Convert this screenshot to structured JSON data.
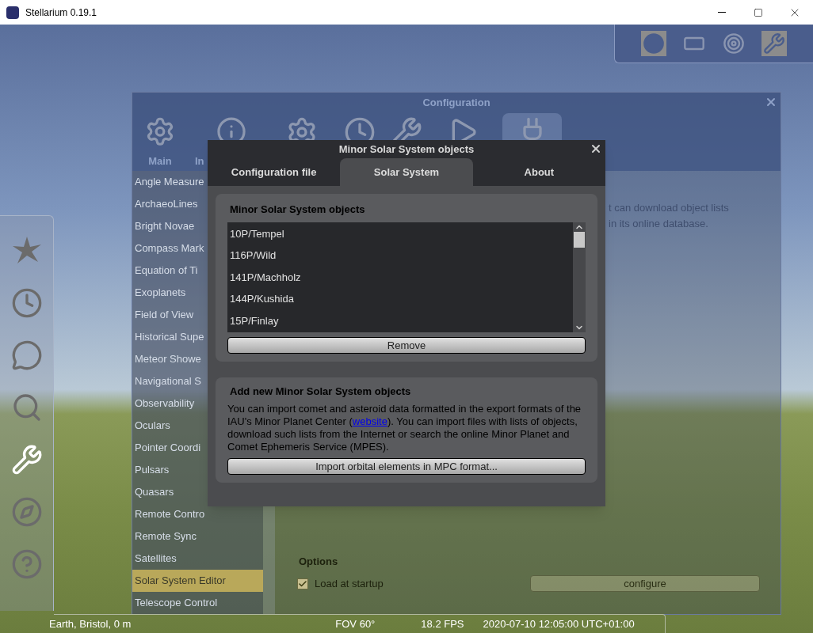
{
  "window": {
    "title": "Stellarium 0.19.1"
  },
  "configuration": {
    "title": "Configuration",
    "tabs": [
      {
        "label": "Main",
        "selected": false
      },
      {
        "label": "In",
        "selected": false
      },
      {
        "selected": false
      },
      {
        "selected": false
      },
      {
        "selected": false
      },
      {
        "selected": false
      },
      {
        "selected": true
      }
    ],
    "plugins": [
      {
        "label": "Angle Measure",
        "selected": false
      },
      {
        "label": "ArchaeoLines",
        "selected": false
      },
      {
        "label": "Bright Novae",
        "selected": false
      },
      {
        "label": "Compass Mark",
        "selected": false
      },
      {
        "label": "Equation of Ti",
        "selected": false
      },
      {
        "label": "Exoplanets",
        "selected": false
      },
      {
        "label": "Field of View",
        "selected": false
      },
      {
        "label": "Historical Supe",
        "selected": false
      },
      {
        "label": "Meteor Showe",
        "selected": false
      },
      {
        "label": "Navigational S",
        "selected": false
      },
      {
        "label": "Observability",
        "selected": false
      },
      {
        "label": "Oculars",
        "selected": false
      },
      {
        "label": "Pointer Coordi",
        "selected": false
      },
      {
        "label": "Pulsars",
        "selected": false
      },
      {
        "label": "Quasars",
        "selected": false
      },
      {
        "label": "Remote Contro",
        "selected": false
      },
      {
        "label": "Remote Sync",
        "selected": false
      },
      {
        "label": "Satellites",
        "selected": false
      },
      {
        "label": "Solar System Editor",
        "selected": true
      },
      {
        "label": "Telescope Control",
        "selected": false
      }
    ],
    "description": [
      "t can download object lists",
      "in its online database."
    ],
    "options": {
      "heading": "Options",
      "load_at_startup": {
        "label": "Load at startup",
        "checked": true
      },
      "configure_button": "configure"
    }
  },
  "dialog": {
    "title": "Minor Solar System objects",
    "tabs": [
      {
        "label": "Configuration file",
        "selected": false
      },
      {
        "label": "Solar System",
        "selected": true
      },
      {
        "label": "About",
        "selected": false
      }
    ],
    "objects_group": {
      "heading": "Minor Solar System objects",
      "items": [
        "10P/Tempel",
        "116P/Wild",
        "141P/Machholz",
        "144P/Kushida",
        "15P/Finlay"
      ],
      "remove_button": "Remove"
    },
    "add_group": {
      "heading": "Add new Minor Solar System objects",
      "text_before": "You can import comet and asteroid data formatted in the export formats of the IAU's Minor Planet Center (",
      "link": "website",
      "text_after": "). You can import files with lists of objects, download such lists from the Internet or search the online Minor Planet and Comet Ephemeris Service (MPES).",
      "import_button": "Import orbital elements in MPC format..."
    }
  },
  "left_toolbar": [
    {
      "active": false
    },
    {
      "active": false
    },
    {
      "active": false
    },
    {
      "active": false
    },
    {
      "active": true
    },
    {
      "active": false
    },
    {
      "active": false
    }
  ],
  "top_toolbar": [
    {
      "active": true
    },
    {
      "active": false
    },
    {
      "active": false
    },
    {
      "active": true
    }
  ],
  "status_bar": {
    "location": "Earth, Bristol, 0 m",
    "fov": "FOV 60°",
    "fps": "18.2 FPS",
    "datetime": "2020-07-10 12:05:00 UTC+01:00"
  }
}
